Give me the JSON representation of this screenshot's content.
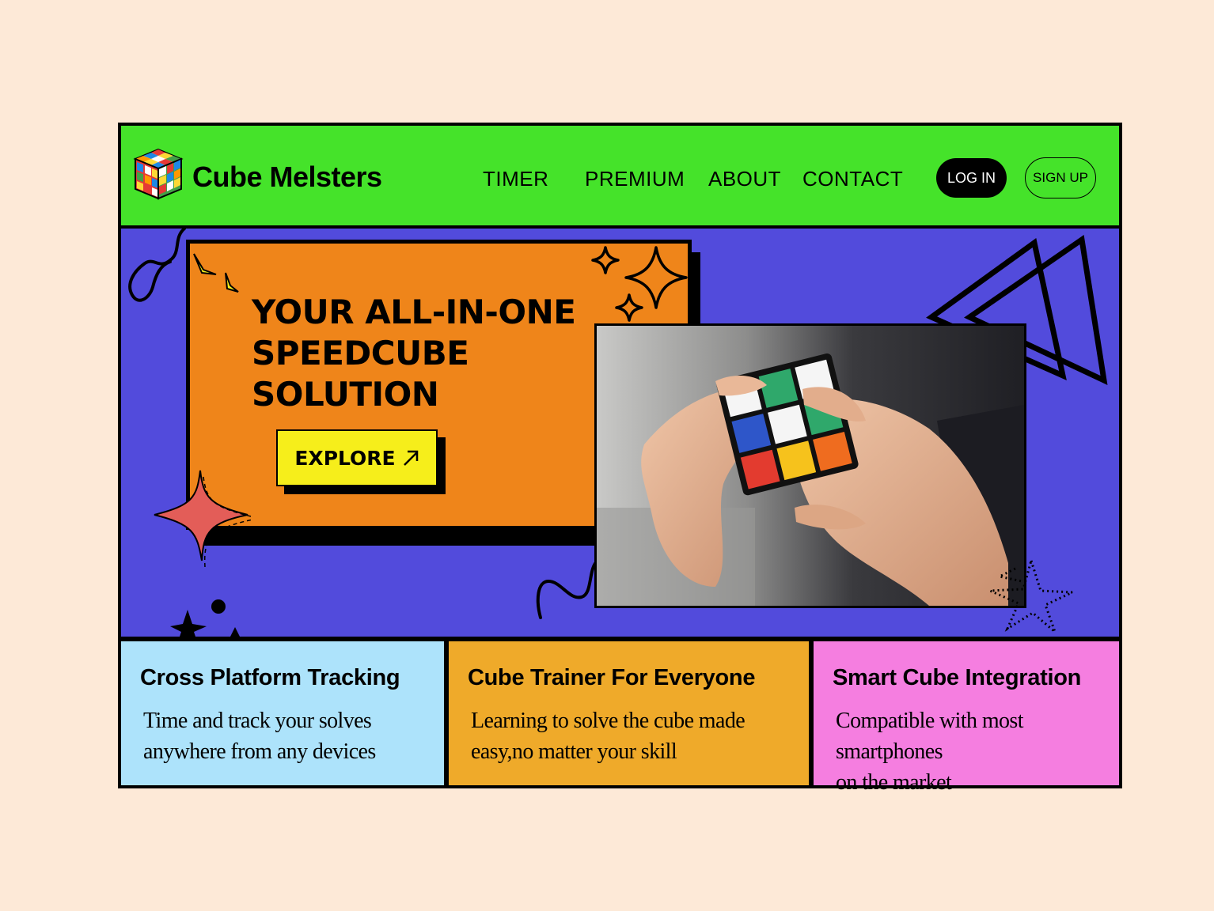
{
  "brand": {
    "name": "Cube Melsters",
    "logo_icon": "rubiks-cube-icon"
  },
  "nav": {
    "items": [
      {
        "label": "TIMER"
      },
      {
        "label": "PREMIUM"
      },
      {
        "label": "ABOUT"
      },
      {
        "label": "CONTACT"
      }
    ],
    "login_label": "LOG IN",
    "signup_label": "SIGN UP"
  },
  "hero": {
    "headline_lines": [
      "YOUR ALL-IN-ONE",
      "SPEEDCUBE",
      "SOLUTION"
    ],
    "cta_label": "EXPLORE",
    "cta_icon": "arrow-up-right-icon",
    "image_icon": "hands-solving-cube-photo"
  },
  "features": [
    {
      "title": "Cross Platform Tracking",
      "desc_lines": [
        "Time and track your solves",
        "anywhere from any devices"
      ]
    },
    {
      "title": "Cube Trainer For Everyone",
      "desc_lines": [
        "Learning to solve the cube made",
        "easy,no matter your skill"
      ]
    },
    {
      "title": "Smart Cube Integration",
      "desc_lines": [
        "Compatible with most smartphones",
        "on the market"
      ]
    }
  ],
  "colors": {
    "page_bg": "#fde9d7",
    "header_bg": "#45e32a",
    "hero_bg": "#524bdc",
    "card_bg": "#ef851a",
    "cta_bg": "#f6ee1b",
    "feature_1_bg": "#ade3fb",
    "feature_2_bg": "#efaa2a",
    "feature_3_bg": "#f57ee0"
  }
}
